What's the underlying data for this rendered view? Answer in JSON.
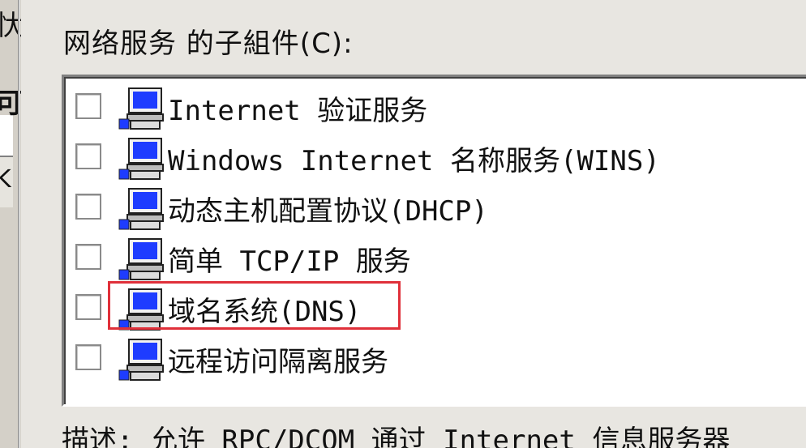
{
  "left_fragments": [
    "忕",
    "可",
    "K"
  ],
  "group_label": "网络服务 的子組件(C):",
  "components": [
    {
      "label": "Internet 验证服务",
      "checked": false,
      "icon": "computer-icon"
    },
    {
      "label": "Windows Internet 名称服务(WINS)",
      "checked": false,
      "icon": "computer-icon"
    },
    {
      "label": "动态主机配置协议(DHCP)",
      "checked": false,
      "icon": "computer-icon"
    },
    {
      "label": "简单 TCP/IP 服务",
      "checked": false,
      "icon": "computer-icon"
    },
    {
      "label": "域名系统(DNS)",
      "checked": false,
      "icon": "computer-icon",
      "highlighted": true
    },
    {
      "label": "远程访问隔离服务",
      "checked": false,
      "icon": "computer-icon"
    }
  ],
  "description": "描述: 允许 RPC/DCOM 通过 Internet 信息服务器",
  "colors": {
    "dialog_bg": "#d4d0c8",
    "list_bg": "#ffffff",
    "highlight": "#e0303a",
    "icon_screen": "#1e3cff"
  }
}
